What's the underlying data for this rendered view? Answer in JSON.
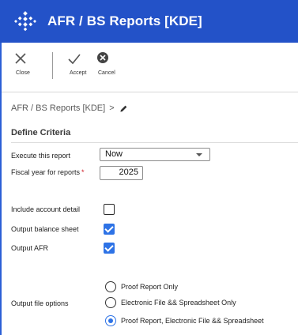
{
  "window": {
    "title": "AFR / BS Reports [KDE]"
  },
  "toolbar": {
    "close_label": "Close",
    "accept_label": "Accept",
    "cancel_label": "Cancel"
  },
  "breadcrumb": {
    "text": "AFR / BS Reports [KDE]",
    "separator": ">"
  },
  "section": {
    "title": "Define Criteria"
  },
  "fields": {
    "execute_label": "Execute this report",
    "execute_value": "Now",
    "fiscal_label": "Fiscal year for reports",
    "fiscal_required": "*",
    "fiscal_value": "2025",
    "include_detail_label": "Include account detail",
    "include_detail_checked": false,
    "balance_sheet_label": "Output balance sheet",
    "balance_sheet_checked": true,
    "output_afr_label": "Output AFR",
    "output_afr_checked": true,
    "file_options_label": "Output file options",
    "file_options": [
      "Proof Report Only",
      "Electronic File && Spreadsheet Only",
      "Proof Report, Electronic File && Spreadsheet"
    ],
    "file_options_selected": "Proof Report, Electronic File && Spreadsheet"
  },
  "colors": {
    "titlebar": "#2352c8",
    "accent": "#2e73e6",
    "required": "#d0202a"
  },
  "icons": {
    "logo": "diamond-dots-logo-icon",
    "close": "x-icon",
    "accept": "checkmark-icon",
    "cancel": "x-circle-icon",
    "edit": "pencil-icon"
  }
}
